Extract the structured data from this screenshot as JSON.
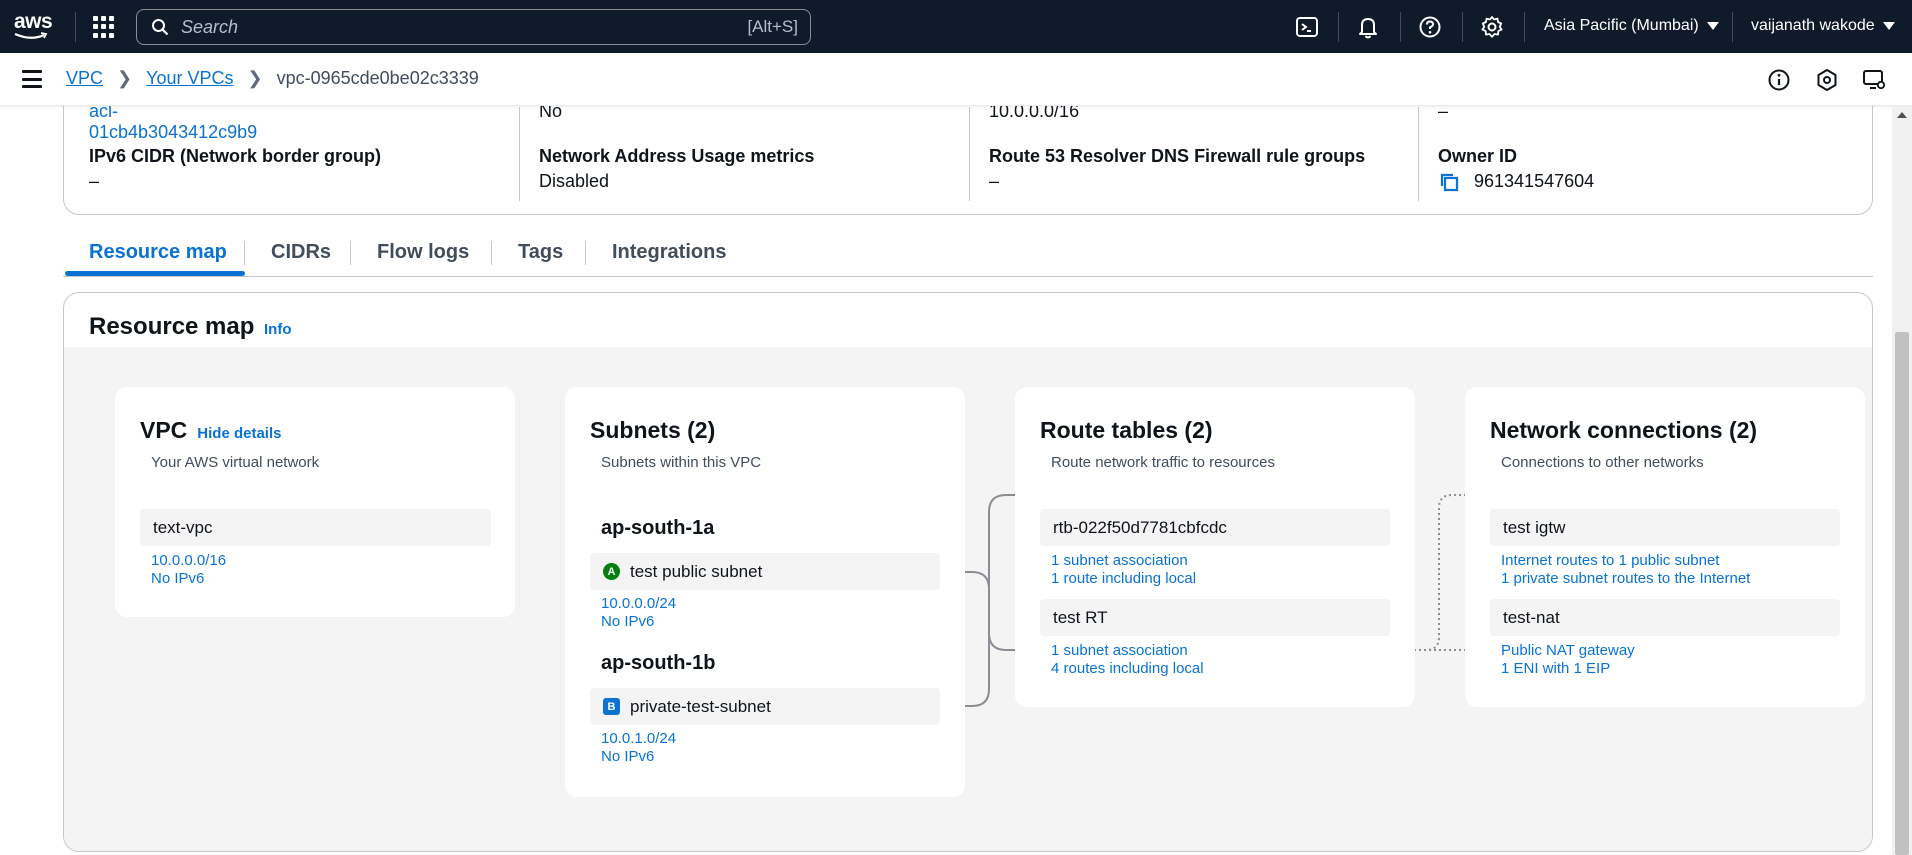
{
  "topnav": {
    "logo": "aws",
    "search_placeholder": "Search",
    "search_shortcut": "[Alt+S]",
    "region": "Asia Pacific (Mumbai)",
    "user": "vaijanath wakode"
  },
  "breadcrumb": {
    "items": [
      "VPC",
      "Your VPCs"
    ],
    "current": "vpc-0965cde0be02c3339",
    "separator": ">"
  },
  "details": {
    "col1": {
      "top_value": "acl-01cb4b3043412c9b9",
      "label": "IPv6 CIDR (Network border group)",
      "value": "–"
    },
    "col2": {
      "top_value": "No",
      "label": "Network Address Usage metrics",
      "value": "Disabled"
    },
    "col3": {
      "top_value": "10.0.0.0/16",
      "label": "Route 53 Resolver DNS Firewall rule groups",
      "value": "–"
    },
    "col4": {
      "top_value": "–",
      "label": "Owner ID",
      "value": "961341547604"
    }
  },
  "tabs": [
    {
      "label": "Resource map",
      "active": true
    },
    {
      "label": "CIDRs"
    },
    {
      "label": "Flow logs"
    },
    {
      "label": "Tags"
    },
    {
      "label": "Integrations"
    }
  ],
  "resource_map": {
    "title": "Resource map",
    "info": "Info",
    "vpc": {
      "title": "VPC",
      "hide_details": "Hide details",
      "subtitle": "Your AWS virtual network",
      "node": "text-vpc",
      "lines": [
        "10.0.0.0/16",
        "No IPv6"
      ]
    },
    "subnets": {
      "title": "Subnets (2)",
      "subtitle": "Subnets within this VPC",
      "groups": [
        {
          "az": "ap-south-1a",
          "badge": "A",
          "node": "test public subnet",
          "lines": [
            "10.0.0.0/24",
            "No IPv6"
          ]
        },
        {
          "az": "ap-south-1b",
          "badge": "B",
          "node": "private-test-subnet",
          "lines": [
            "10.0.1.0/24",
            "No IPv6"
          ]
        }
      ]
    },
    "route_tables": {
      "title": "Route tables (2)",
      "subtitle": "Route network traffic to resources",
      "items": [
        {
          "node": "rtb-022f50d7781cbfcdc",
          "lines": [
            "1 subnet association",
            "1 route including local"
          ]
        },
        {
          "node": "test RT",
          "lines": [
            "1 subnet association",
            "4 routes including local"
          ]
        }
      ]
    },
    "network_connections": {
      "title": "Network connections (2)",
      "subtitle": "Connections to other networks",
      "items": [
        {
          "node": "test igtw",
          "lines": [
            "Internet routes to 1 public subnet",
            "1 private subnet routes to the Internet"
          ]
        },
        {
          "node": "test-nat",
          "lines": [
            "Public NAT gateway",
            "1 ENI with 1 EIP"
          ]
        }
      ]
    }
  },
  "colors": {
    "nav_bg": "#0f1b2a",
    "link": "#0972d3",
    "badge_a": "#037f0c",
    "badge_b": "#0972d3"
  }
}
